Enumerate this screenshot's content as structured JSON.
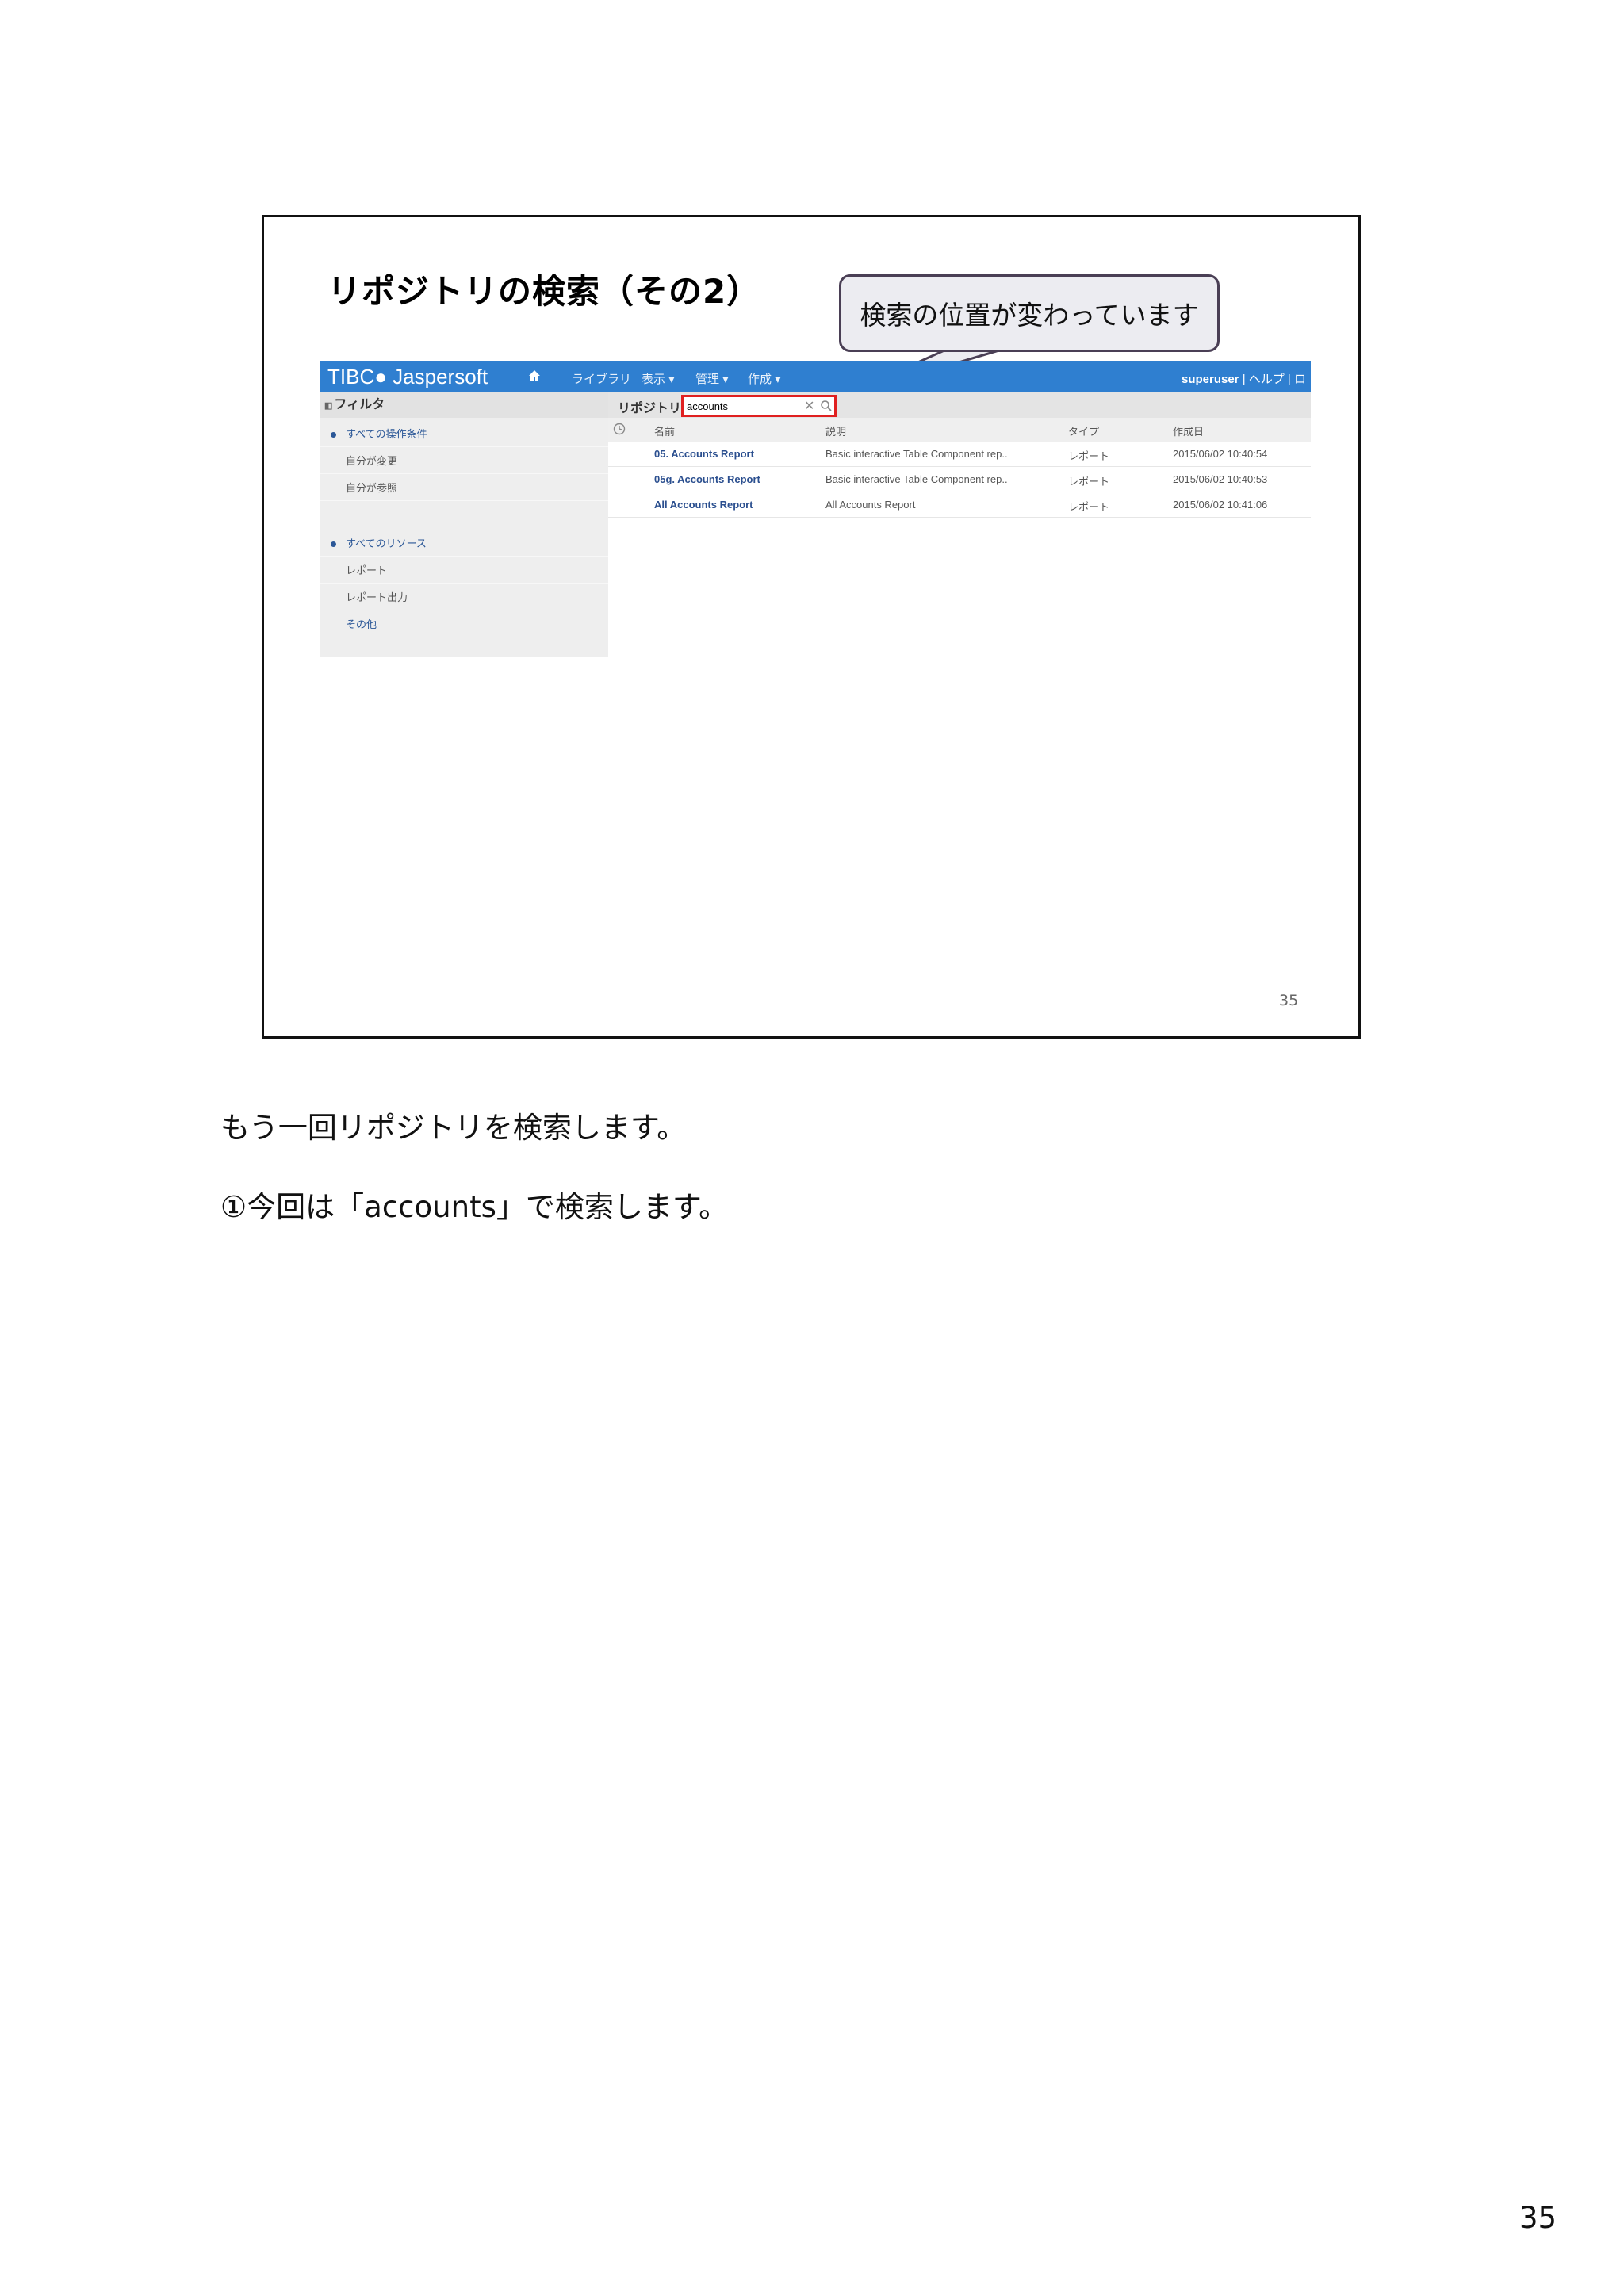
{
  "slide": {
    "title": "リポジトリの検索（その2）",
    "callout": "検索の位置が変わっています",
    "marker": "①",
    "page_number": "35"
  },
  "app": {
    "logo": "TIBC● Jaspersoft",
    "nav": [
      "ライブラリ",
      "表示 ▾",
      "管理 ▾",
      "作成 ▾"
    ],
    "user": "superuser",
    "user_links": "| ヘルプ | ロ",
    "sidebar": {
      "header": "フィルタ",
      "group1": "すべての操作条件",
      "group1_items": [
        "自分が変更",
        "自分が参照"
      ],
      "group2": "すべてのリソース",
      "group2_items": [
        "レポート",
        "レポート出力",
        "その他"
      ]
    },
    "search": {
      "repo_label": "リポジトリ",
      "value": "accounts",
      "clear": "✕"
    },
    "columns": [
      "名前",
      "説明",
      "タイプ",
      "作成日"
    ],
    "rows": [
      {
        "name": "05. Accounts Report",
        "desc": "Basic interactive Table Component rep..",
        "type": "レポート",
        "date": "2015/06/02 10:40:54"
      },
      {
        "name": "05g. Accounts Report",
        "desc": "Basic interactive Table Component rep..",
        "type": "レポート",
        "date": "2015/06/02 10:40:53"
      },
      {
        "name": "All Accounts Report",
        "desc": "All Accounts Report",
        "type": "レポート",
        "date": "2015/06/02 10:41:06"
      }
    ]
  },
  "notes": {
    "line1": "もう一回リポジトリを検索します。",
    "line2": "①今回は「accounts」で検索します。"
  },
  "page_number": "35"
}
